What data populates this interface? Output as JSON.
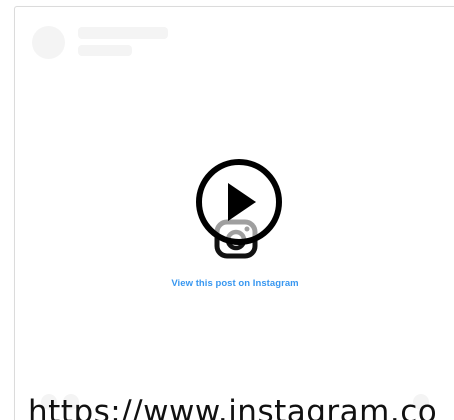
{
  "embed": {
    "view_link_label": "View this post on Instagram",
    "url_text": "https://www.instagram.co",
    "link_color": "#3897f0",
    "placeholder_color": "#f4f4f4",
    "icons": {
      "play": "play-icon",
      "instagram": "instagram-logo-icon"
    }
  }
}
